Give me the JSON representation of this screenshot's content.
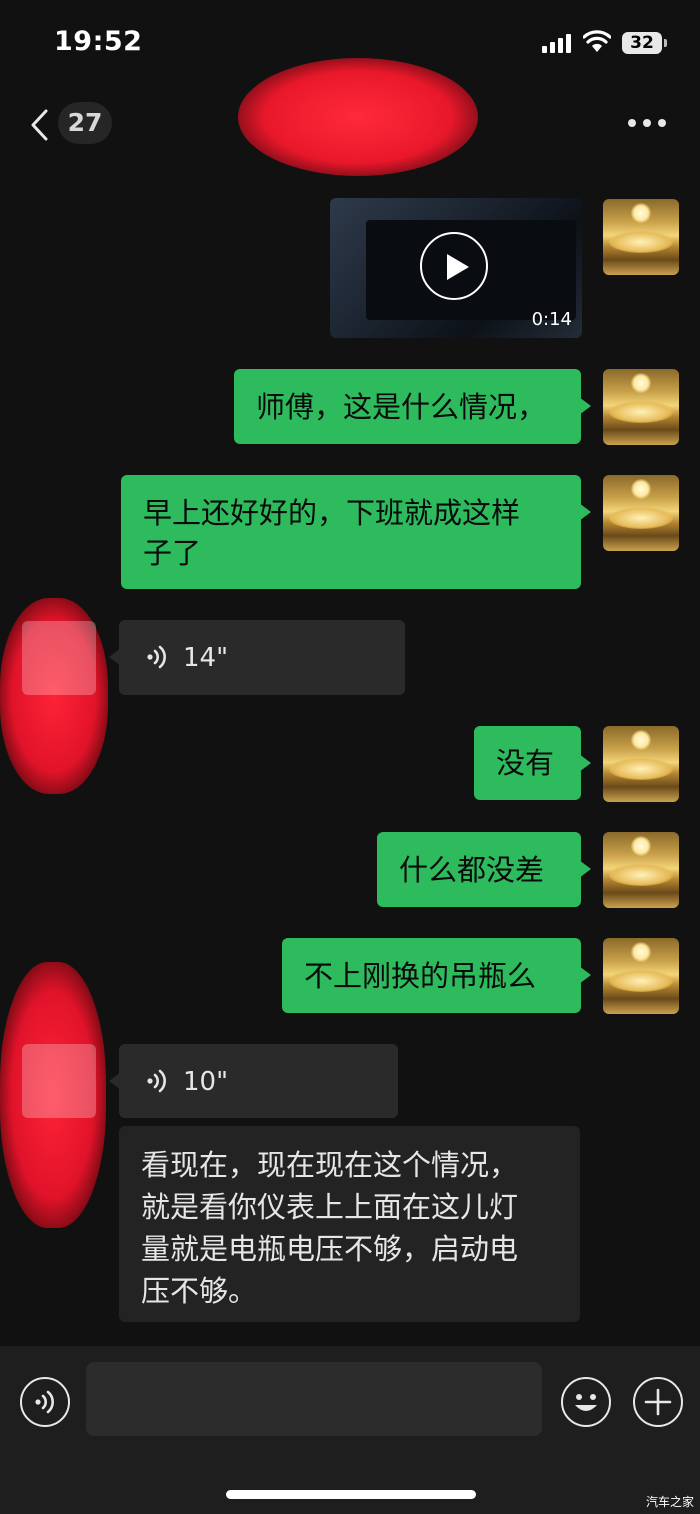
{
  "status_bar": {
    "time": "19:52",
    "battery": "32"
  },
  "header": {
    "unread_count": "27",
    "back_icon": "chevron-left-icon",
    "more_icon": "ellipsis-icon"
  },
  "messages": {
    "video": {
      "duration": "0:14"
    },
    "m1": "师傅，这是什么情况，",
    "m2": "早上还好好的，下班就成这样\n子了",
    "voice1": "14\"",
    "m3": "没有",
    "m4": "什么都没差",
    "m5": "不上刚换的吊瓶么",
    "voice2": "10\"",
    "transcript": "看现在，现在现在这个情况，\n就是看你仪表上上面在这儿灯\n量就是电瓶电压不够，启动电\n压不够。"
  },
  "input_bar": {
    "voice_icon": "voice-icon",
    "emoji_icon": "emoji-icon",
    "plus_icon": "plus-icon"
  },
  "watermark": "汽车之家",
  "colors": {
    "background": "#111111",
    "sent_bubble": "#2dbb5e",
    "received_bubble": "#2a2a2a"
  }
}
